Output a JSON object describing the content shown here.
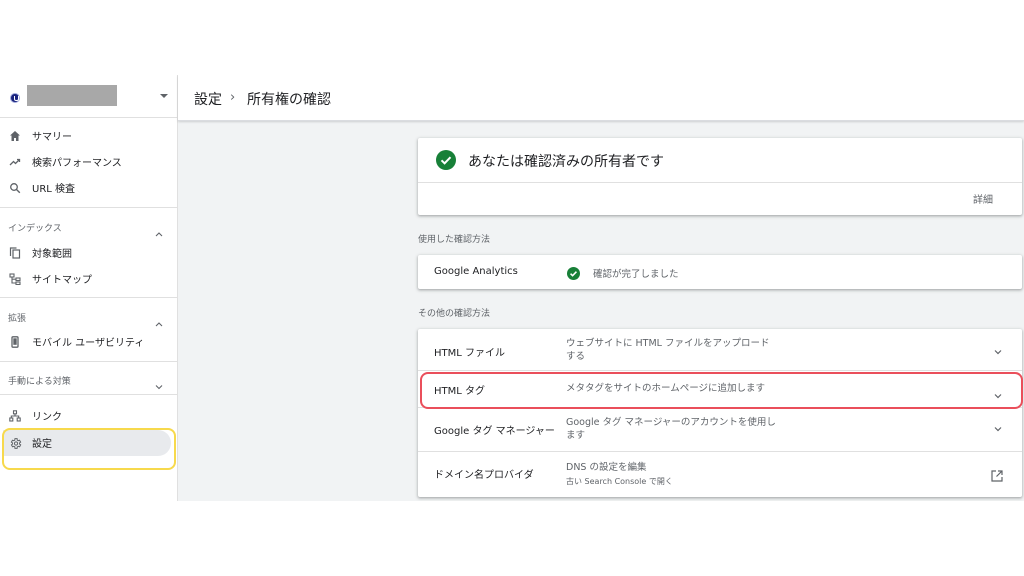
{
  "colors": {
    "accent_green": "#188038",
    "highlight_yellow": "#f7d94c",
    "highlight_red": "#ea4f5b",
    "sidebar_bg": "#ffffff",
    "content_bg": "#f1f3f4"
  },
  "sidebar": {
    "property_icon": "property-favicon-icon",
    "main_items": [
      {
        "label": "サマリー",
        "icon": "home-icon"
      },
      {
        "label": "検索パフォーマンス",
        "icon": "trending-up-icon"
      },
      {
        "label": "URL 検査",
        "icon": "search-icon"
      }
    ],
    "sections": [
      {
        "label": "インデックス",
        "expanded": true,
        "items": [
          {
            "label": "対象範囲",
            "icon": "copy-icon"
          },
          {
            "label": "サイトマップ",
            "icon": "sitemap-icon"
          }
        ]
      },
      {
        "label": "拡張",
        "expanded": true,
        "items": [
          {
            "label": "モバイル ユーザビリティ",
            "icon": "phone-icon"
          }
        ]
      },
      {
        "label": "手動による対策",
        "expanded": false,
        "items": []
      }
    ],
    "bottom_items": [
      {
        "label": "リンク",
        "icon": "links-icon"
      },
      {
        "label": "設定",
        "icon": "gear-icon",
        "active": true
      }
    ]
  },
  "header": {
    "breadcrumb": [
      "設定",
      "所有権の確認"
    ],
    "separator": "›"
  },
  "verified_card": {
    "title": "あなたは確認済みの所有者です",
    "details_link": "詳細"
  },
  "used_method": {
    "section_label": "使用した確認方法",
    "name": "Google Analytics",
    "status": "確認が完了しました"
  },
  "other_methods": {
    "section_label": "その他の確認方法",
    "items": [
      {
        "name": "HTML ファイル",
        "desc": "ウェブサイトに HTML ファイルをアップロードする"
      },
      {
        "name": "HTML タグ",
        "desc": "メタタグをサイトのホームページに追加します"
      },
      {
        "name": "Google タグ マネージャー",
        "desc": "Google タグ マネージャーのアカウントを使用します"
      },
      {
        "name": "ドメイン名プロバイダ",
        "desc": "DNS の設定を編集",
        "sub": "古い Search Console で開く"
      }
    ]
  }
}
